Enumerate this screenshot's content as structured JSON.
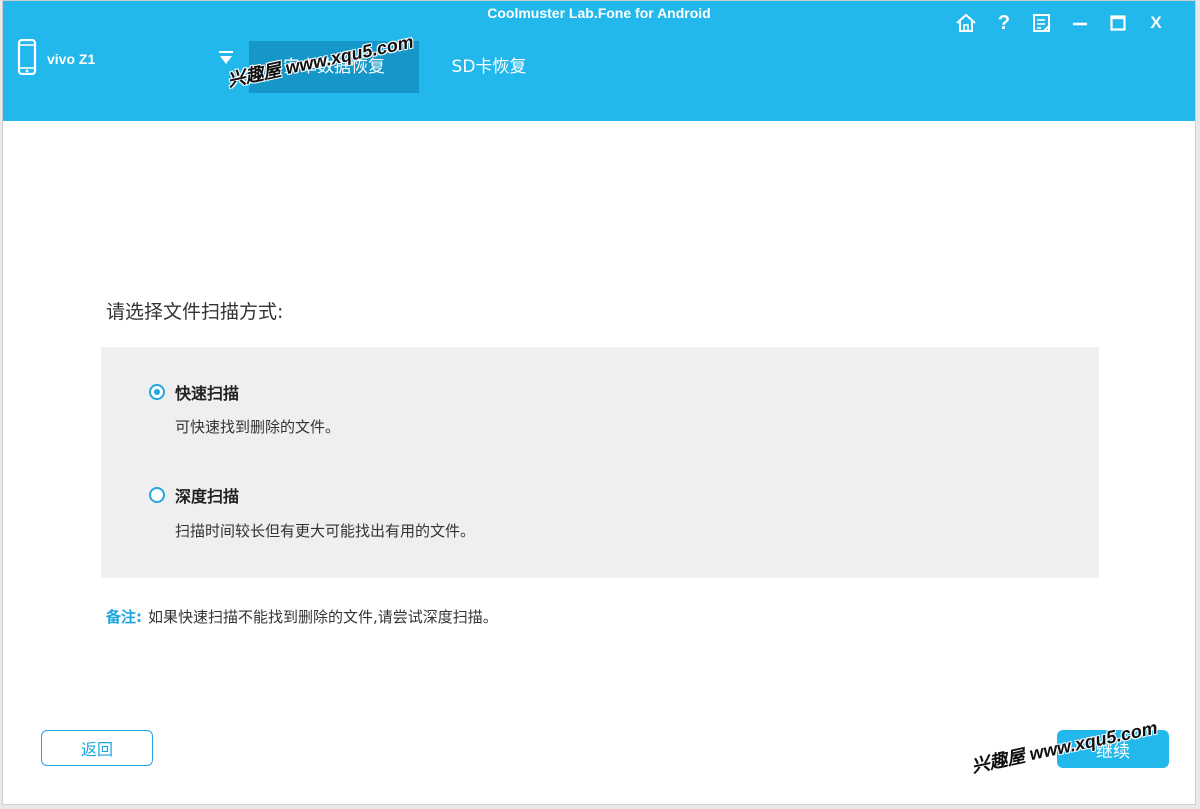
{
  "app": {
    "title": "Coolmuster Lab.Fone for Android",
    "device_name": "vivo Z1"
  },
  "tabs": [
    {
      "label": "安卓数据恢复",
      "active": true
    },
    {
      "label": "SD卡恢复",
      "active": false
    }
  ],
  "window_controls": {
    "help_label": "?",
    "close_label": "X"
  },
  "main": {
    "prompt": "请选择文件扫描方式:",
    "options": [
      {
        "label": "快速扫描",
        "description": "可快速找到删除的文件。",
        "selected": true
      },
      {
        "label": "深度扫描",
        "description": "扫描时间较长但有更大可能找出有用的文件。",
        "selected": false
      }
    ],
    "note_key": "备注:",
    "note_text": "如果快速扫描不能找到删除的文件,请尝试深度扫描。"
  },
  "buttons": {
    "back": "返回",
    "continue": "继续"
  },
  "watermark": {
    "text": "兴趣屋 www.xqu5.com"
  },
  "colors": {
    "header": "#22b8ec",
    "active_tab": "#1598c9",
    "accent": "#22a7e0",
    "panel": "#efefef"
  }
}
